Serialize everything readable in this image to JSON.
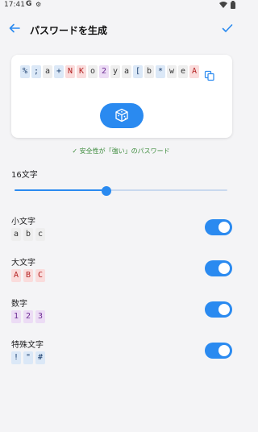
{
  "status": {
    "time": "17:41",
    "g": "G"
  },
  "header": {
    "title": "パスワードを生成"
  },
  "password": {
    "chars": [
      {
        "c": "%",
        "t": "sym"
      },
      {
        "c": ";",
        "t": "sym"
      },
      {
        "c": "a",
        "t": "low"
      },
      {
        "c": "+",
        "t": "sym"
      },
      {
        "c": "N",
        "t": "up"
      },
      {
        "c": "K",
        "t": "up"
      },
      {
        "c": "o",
        "t": "low"
      },
      {
        "c": "2",
        "t": "num"
      },
      {
        "c": "y",
        "t": "low"
      },
      {
        "c": "a",
        "t": "low"
      },
      {
        "c": "[",
        "t": "sym"
      },
      {
        "c": "b",
        "t": "low"
      },
      {
        "c": "*",
        "t": "sym"
      },
      {
        "c": "w",
        "t": "low"
      },
      {
        "c": "e",
        "t": "low"
      },
      {
        "c": "A",
        "t": "up"
      }
    ]
  },
  "strength": {
    "text": "安全性が「強い」のパスワード"
  },
  "length": {
    "label": "16文字",
    "value": 16,
    "fraction": 0.43
  },
  "options": [
    {
      "label": "小文字",
      "samples": [
        "a",
        "b",
        "c"
      ],
      "type": "low",
      "enabled": true
    },
    {
      "label": "大文字",
      "samples": [
        "A",
        "B",
        "C"
      ],
      "type": "up",
      "enabled": true
    },
    {
      "label": "数字",
      "samples": [
        "1",
        "2",
        "3"
      ],
      "type": "num",
      "enabled": true
    },
    {
      "label": "特殊文字",
      "samples": [
        "!",
        "\"",
        "#"
      ],
      "type": "sym",
      "enabled": true
    }
  ],
  "colors": {
    "accent": "#2a8af0",
    "symbol_bg": "#dbe8f7",
    "upper_bg": "#fadcdc",
    "number_bg": "#ecdcf5",
    "lower_bg": "#eeeeee",
    "strength": "#3a8a3a"
  },
  "icons": [
    "back-arrow-icon",
    "check-icon",
    "copy-icon",
    "dice-icon",
    "wifi-icon",
    "battery-icon",
    "settings-icon"
  ]
}
